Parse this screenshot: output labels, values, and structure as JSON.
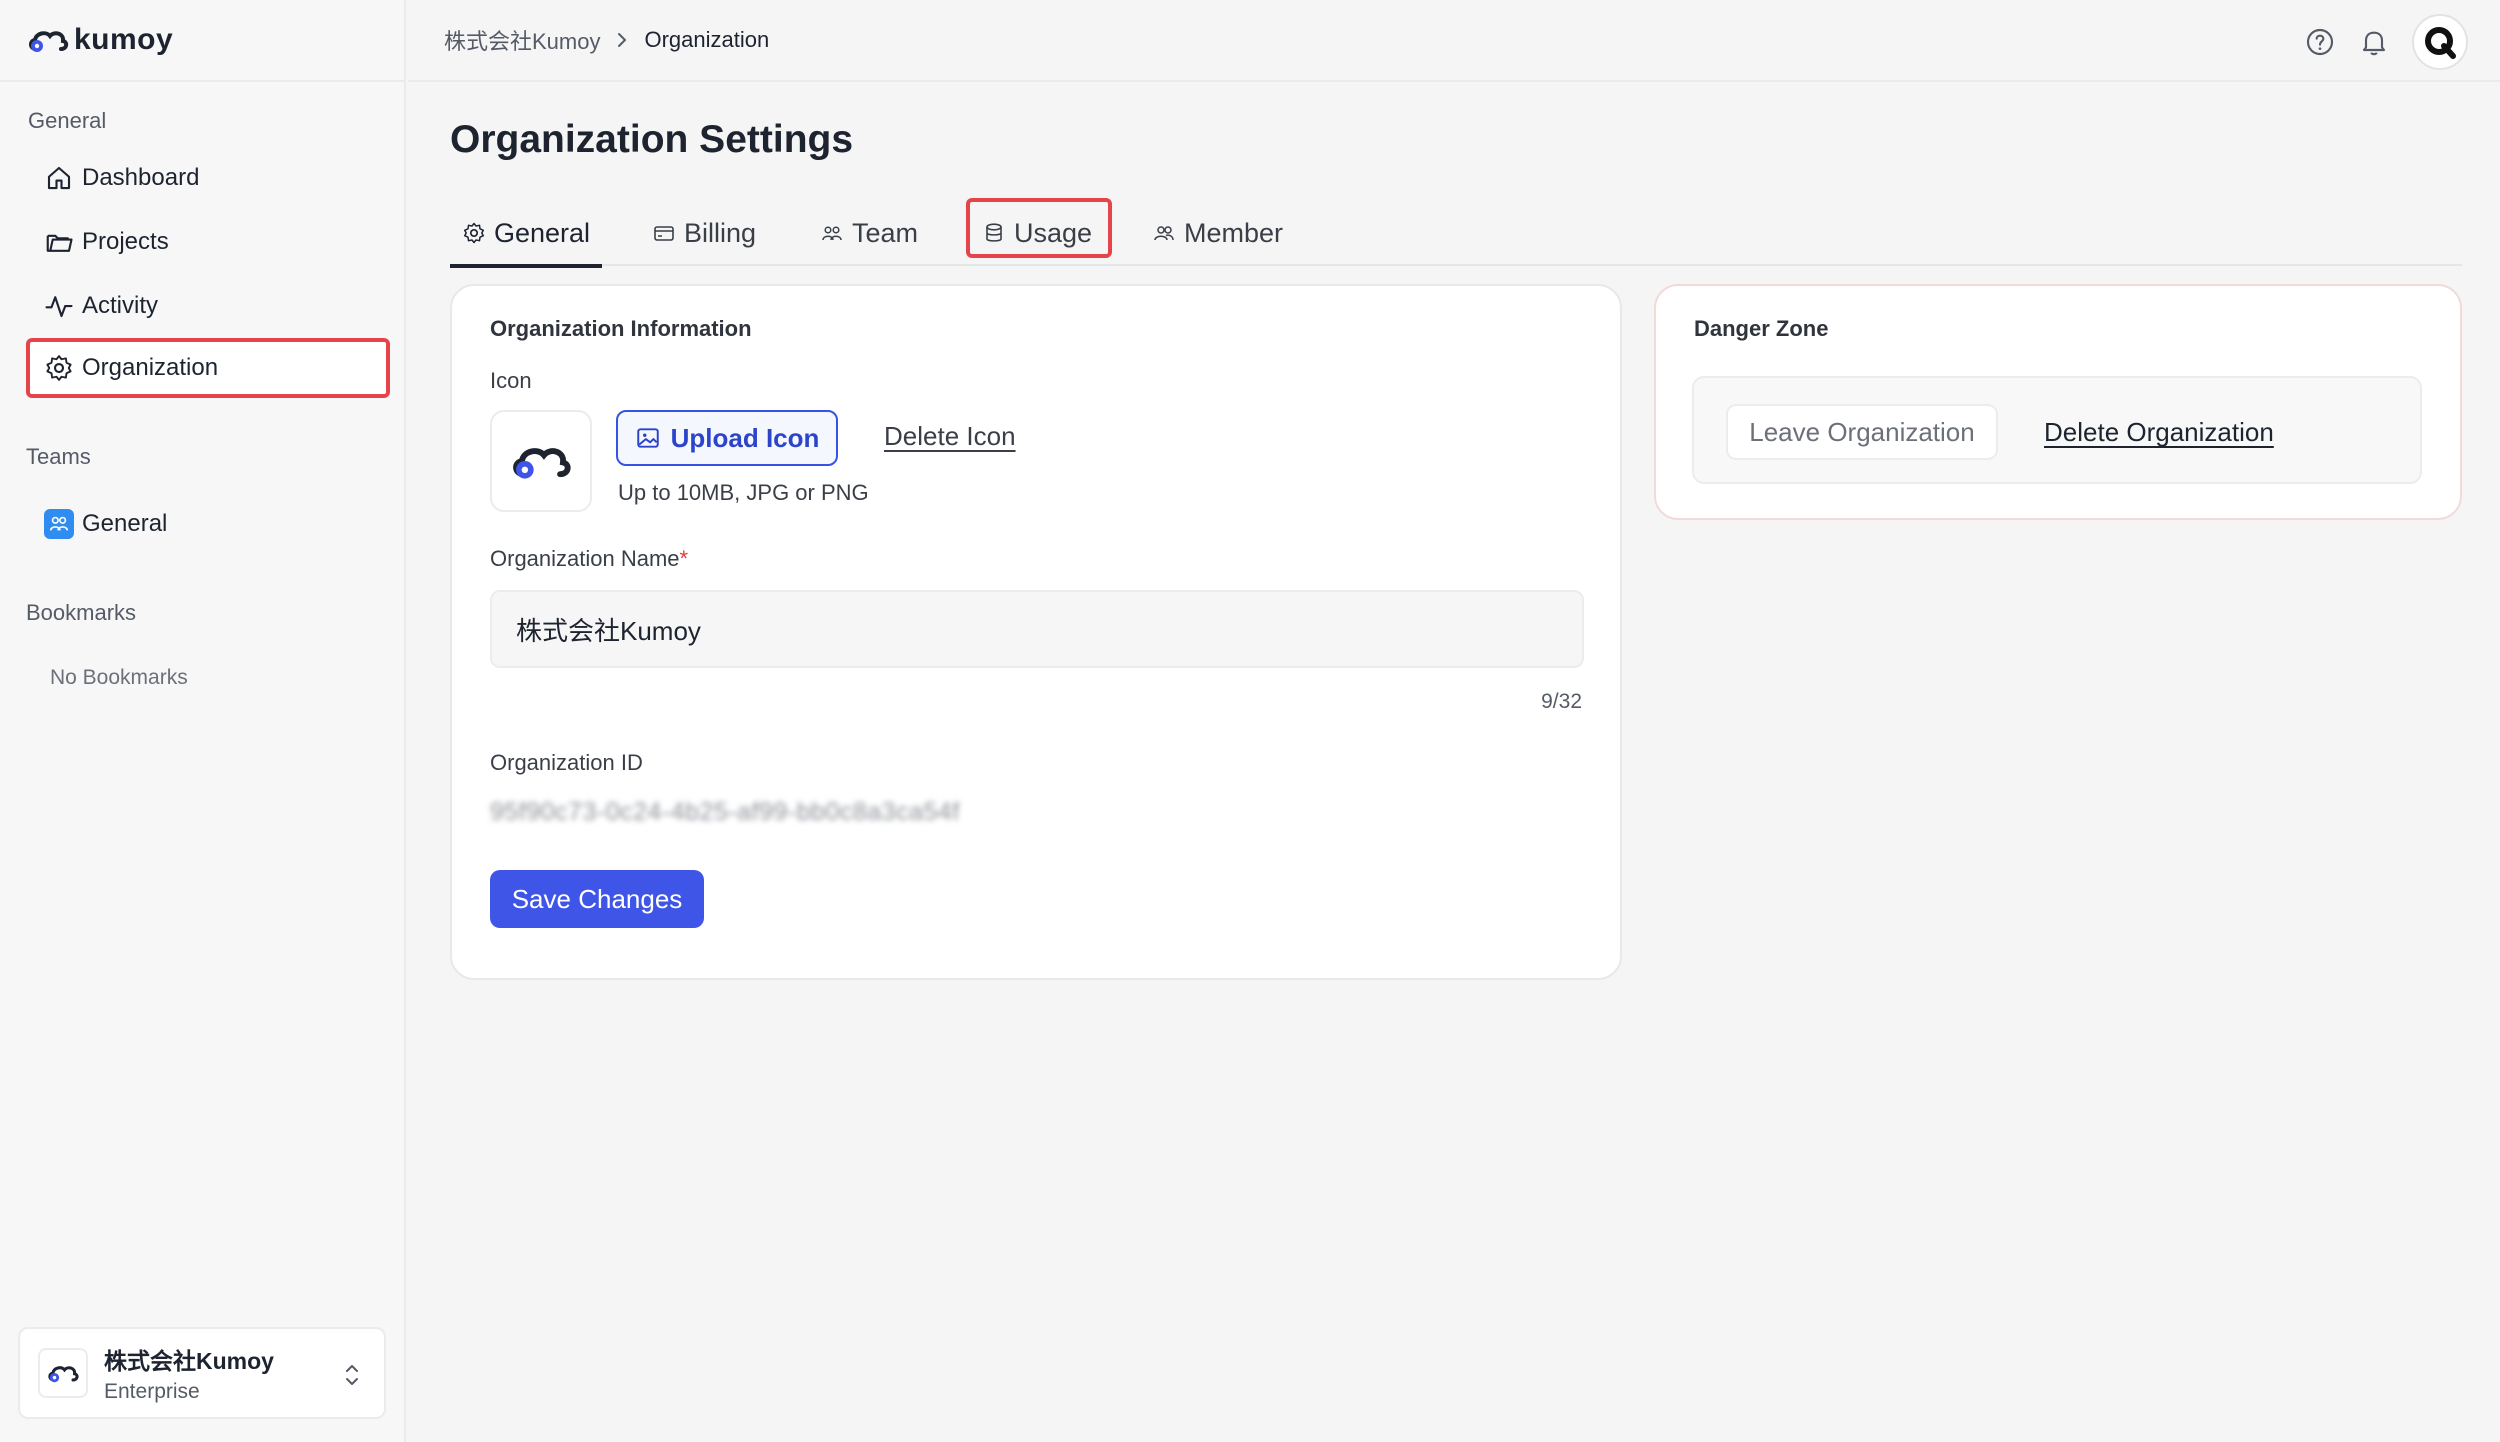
{
  "brand": {
    "name": "kumoy",
    "color": "#3f55e8"
  },
  "sidebar": {
    "general_label": "General",
    "items": [
      {
        "label": "Dashboard",
        "icon": "home-icon"
      },
      {
        "label": "Projects",
        "icon": "folder-icon"
      },
      {
        "label": "Activity",
        "icon": "activity-icon"
      },
      {
        "label": "Organization",
        "icon": "gear-icon",
        "active": true
      }
    ],
    "teams_label": "Teams",
    "teams": [
      {
        "label": "General",
        "icon": "team-icon"
      }
    ],
    "bookmarks_label": "Bookmarks",
    "no_bookmarks": "No Bookmarks",
    "org_switcher": {
      "name": "株式会社Kumoy",
      "plan": "Enterprise"
    }
  },
  "breadcrumb": {
    "parent": "株式会社Kumoy",
    "current": "Organization"
  },
  "page": {
    "title": "Organization Settings",
    "tabs": [
      {
        "label": "General",
        "icon": "gear-icon",
        "active": true
      },
      {
        "label": "Billing",
        "icon": "card-icon"
      },
      {
        "label": "Team",
        "icon": "team-icon"
      },
      {
        "label": "Usage",
        "icon": "database-icon",
        "highlighted": true
      },
      {
        "label": "Member",
        "icon": "users-icon"
      }
    ]
  },
  "org_info": {
    "title": "Organization Information",
    "icon_label": "Icon",
    "upload_label": "Upload Icon",
    "delete_icon_label": "Delete Icon",
    "upload_hint": "Up to 10MB, JPG or PNG",
    "name_label": "Organization Name",
    "required_mark": "*",
    "name_value": "株式会社Kumoy",
    "name_counter": "9/32",
    "id_label": "Organization ID",
    "id_value": "95f90c73-0c24-4b25-af99-bb0c8a3ca54f",
    "save_label": "Save Changes"
  },
  "danger_zone": {
    "title": "Danger Zone",
    "leave_label": "Leave Organization",
    "delete_label": "Delete Organization"
  },
  "colors": {
    "highlight": "#e5454a",
    "primary": "#3f55e8",
    "team_badge": "#2f8cf0"
  }
}
